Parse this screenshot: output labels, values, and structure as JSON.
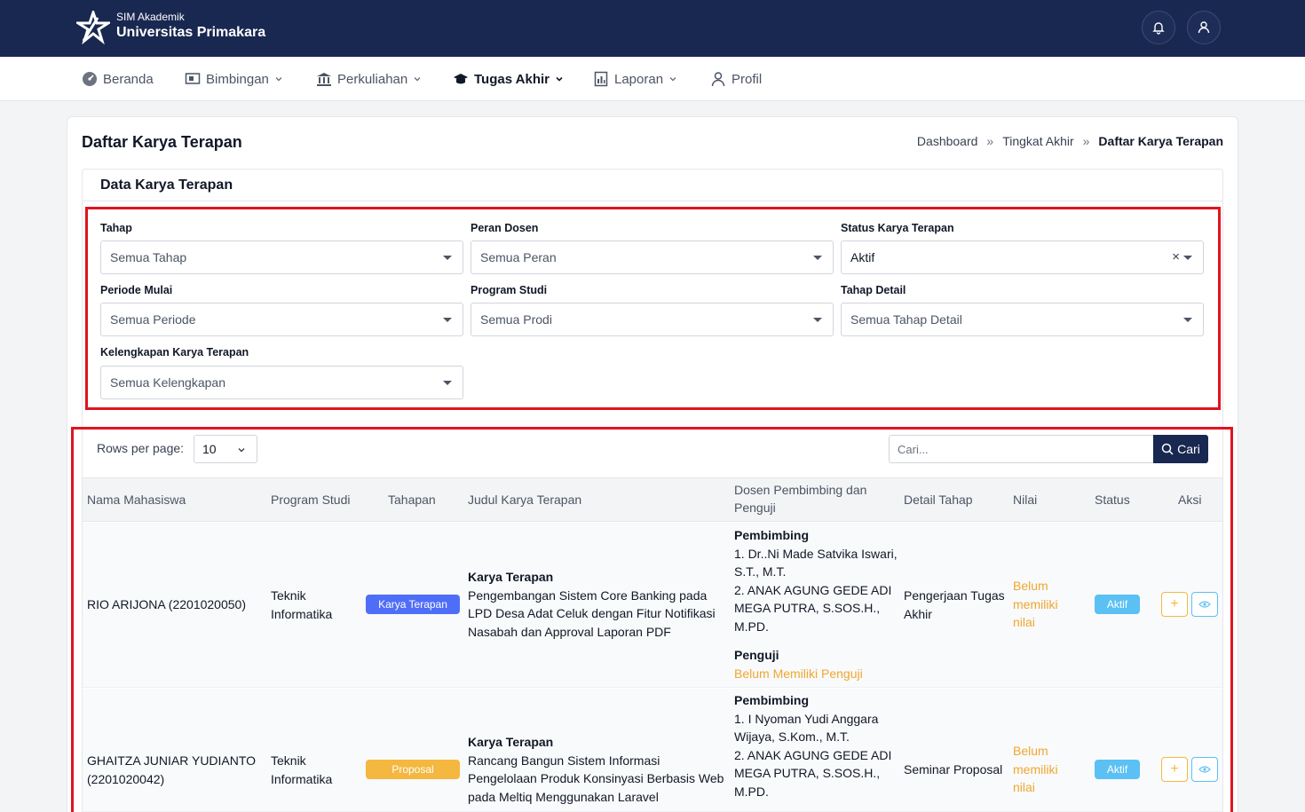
{
  "header": {
    "brand_sub": "SIM Akademik",
    "brand_name": "Universitas Primakara",
    "notification_icon": "bell-icon",
    "profile_icon": "user-icon"
  },
  "nav": [
    {
      "label": "Beranda",
      "icon": "dashboard-icon",
      "dropdown": false
    },
    {
      "label": "Bimbingan",
      "icon": "presentation-icon",
      "dropdown": true
    },
    {
      "label": "Perkuliahan",
      "icon": "building-icon",
      "dropdown": true
    },
    {
      "label": "Tugas Akhir",
      "icon": "graduation-cap-icon",
      "dropdown": true,
      "active": true
    },
    {
      "label": "Laporan",
      "icon": "report-icon",
      "dropdown": true
    },
    {
      "label": "Profil",
      "icon": "user-icon",
      "dropdown": false
    }
  ],
  "page": {
    "title": "Daftar Karya Terapan",
    "breadcrumb": [
      "Dashboard",
      "Tingkat Akhir",
      "Daftar Karya Terapan"
    ],
    "breadcrumb_sep": "»",
    "card_title": "Data Karya Terapan"
  },
  "filters": {
    "tahap": {
      "label": "Tahap",
      "value": "Semua Tahap"
    },
    "peran": {
      "label": "Peran Dosen",
      "value": "Semua Peran"
    },
    "status": {
      "label": "Status Karya Terapan",
      "value": "Aktif",
      "clear": "×"
    },
    "periode": {
      "label": "Periode Mulai",
      "value": "Semua Periode"
    },
    "prodi": {
      "label": "Program Studi",
      "value": "Semua Prodi"
    },
    "tahap_detail": {
      "label": "Tahap Detail",
      "value": "Semua Tahap Detail"
    },
    "kelengkapan": {
      "label": "Kelengkapan Karya Terapan",
      "value": "Semua Kelengkapan"
    }
  },
  "table_controls": {
    "rows_per_page_label": "Rows per page:",
    "rows_per_page_value": "10",
    "search_placeholder": "Cari...",
    "search_button": "Cari"
  },
  "table": {
    "columns": [
      "Nama Mahasiswa",
      "Program Studi",
      "Tahapan",
      "Judul Karya Terapan",
      "Dosen Pembimbing dan",
      "Penguji",
      "Detail Tahap",
      "Nilai",
      "Status",
      "Aksi"
    ],
    "rows": [
      {
        "nama": "RIO ARIJONA (2201020050)",
        "prodi_1": "Teknik",
        "prodi_2": "Informatika",
        "tahapan": "Karya Terapan",
        "judul_head": "Karya Terapan",
        "judul_lines": [
          "Pengembangan Sistem Core Banking pada",
          "LPD Desa Adat Celuk dengan Fitur Notifikasi",
          "Nasabah dan Approval Laporan PDF"
        ],
        "pembimbing_head": "Pembimbing",
        "pembimbing_lines": [
          "1. Dr..Ni Made Satvika Iswari,",
          "S.T., M.T.",
          "2. ANAK AGUNG GEDE ADI",
          "MEGA PUTRA, S.SOS.H.,",
          "M.PD."
        ],
        "penguji_head": "Penguji",
        "penguji_value": "Belum Memiliki Penguji",
        "detail_1": "Pengerjaan Tugas",
        "detail_2": "Akhir",
        "nilai_lines": [
          "Belum",
          "memiliki",
          "nilai"
        ],
        "status": "Aktif"
      },
      {
        "nama_1": "GHAITZA JUNIAR YUDIANTO",
        "nama_2": "(2201020042)",
        "prodi_1": "Teknik",
        "prodi_2": "Informatika",
        "tahapan": "Proposal",
        "judul_head": "Karya Terapan",
        "judul_lines": [
          "Rancang Bangun Sistem Informasi",
          "Pengelolaan Produk Konsinyasi Berbasis Web",
          "pada Meltiq Menggunakan Laravel"
        ],
        "pembimbing_head": "Pembimbing",
        "pembimbing_lines": [
          "1. I Nyoman Yudi Anggara",
          "Wijaya, S.Kom., M.T.",
          "2. ANAK AGUNG GEDE ADI",
          "MEGA PUTRA, S.SOS.H.,",
          "M.PD."
        ],
        "detail_1": "Seminar Proposal",
        "nilai_lines": [
          "Belum",
          "memiliki",
          "nilai"
        ],
        "status": "Aktif"
      }
    ],
    "action_add": "+"
  },
  "colors": {
    "navy": "#192851",
    "highlight_red": "#e0141e",
    "badge_blue": "#4f6ef7",
    "badge_yellow": "#f4b740",
    "badge_cyan": "#5bc0f3",
    "orange_text": "#f0a630"
  }
}
